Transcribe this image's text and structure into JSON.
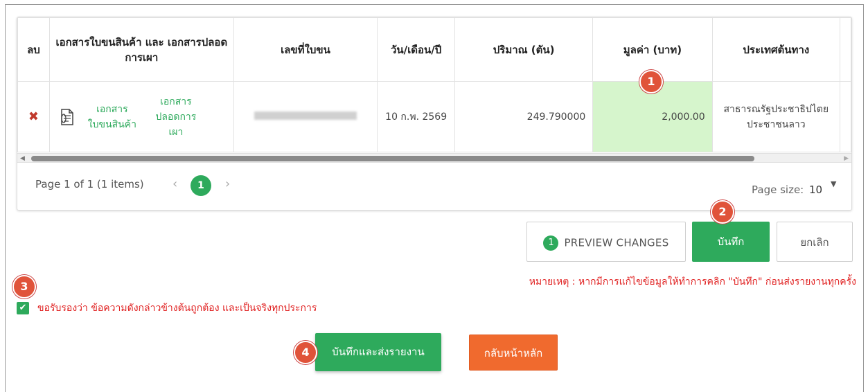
{
  "grid": {
    "headers": {
      "delete": "ลบ",
      "documents": "เอกสารใบขนสินค้า และ เอกสารปลอดการเผา",
      "doc_no": "เลขที่ใบขน",
      "date": "วัน/เดือน/ปี",
      "quantity": "ปริมาณ (ตัน)",
      "value": "มูลค่า (บาท)",
      "origin": "ประเทศต้นทาง"
    },
    "row": {
      "doc_link_1": "เอกสาร ใบขนสินค้า",
      "doc_link_2": "เอกสาร ปลอดการเผา",
      "date": "10 ก.พ. 2569",
      "quantity": "249.790000",
      "value": "2,000.00",
      "origin": "สาธารณรัฐประชาธิปไตยประชาชนลาว"
    }
  },
  "pager": {
    "summary": "Page 1 of 1 (1 items)",
    "current_page": "1",
    "page_size_label": "Page size:",
    "page_size_value": "10"
  },
  "actions": {
    "preview_count": "1",
    "preview_label": "PREVIEW CHANGES",
    "save_label": "บันทึก",
    "cancel_label": "ยกเลิก",
    "note": "หมายเหตุ : หากมีการแก้ไขข้อมูลให้ทำการคลิก \"บันทึก\" ก่อนส่งรายงานทุกครั้ง",
    "certify_text": "ขอรับรองว่า ข้อความดังกล่าวข้างต้นถูกต้อง และเป็นจริงทุกประการ",
    "certify_checked": true,
    "submit_label": "บันทึกและส่งรายงาน",
    "home_label": "กลับหน้าหลัก"
  },
  "markers": [
    "1",
    "2",
    "3",
    "4"
  ],
  "colors": {
    "accent_green": "#2eaa5c",
    "highlight_cell": "#d6f5cc",
    "warning_red": "#e02020",
    "home_orange": "#f06a2e",
    "marker_red": "#e0533a"
  },
  "icons": {
    "delete": "delete-x-icon",
    "document": "document-icon",
    "checkbox": "checkmark-icon"
  }
}
